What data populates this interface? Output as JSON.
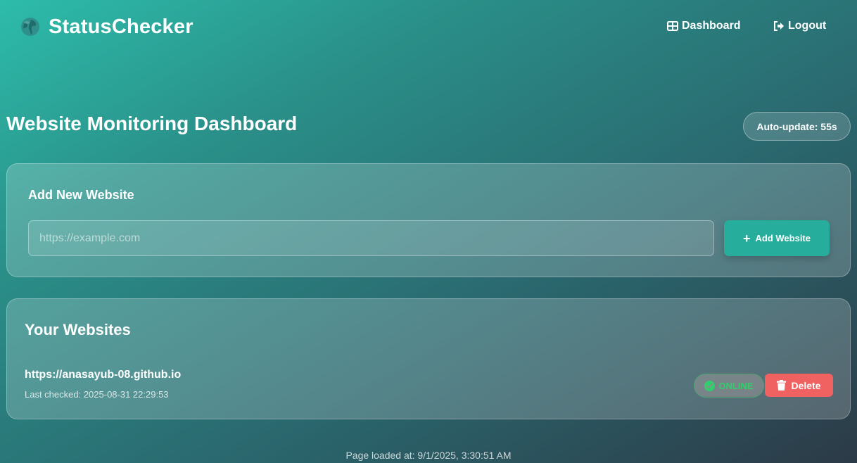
{
  "nav": {
    "brand_icon": "globe-icon",
    "brand_name": "StatusChecker",
    "dashboard_label": "Dashboard",
    "dashboard_icon": "grid-icon",
    "logout_label": "Logout",
    "logout_icon": "logout-icon"
  },
  "header": {
    "title": "Website Monitoring Dashboard",
    "auto_update": "Auto-update: 55s"
  },
  "add_website": {
    "title": "Add New Website",
    "input_placeholder": "https://example.com",
    "input_value": "",
    "button_label": "Add Website",
    "button_icon": "plus-icon"
  },
  "websites": {
    "title": "Your Websites",
    "items": [
      {
        "url": "https://anasayub-08.github.io",
        "last_checked": "Last checked: 2025-08-31 22:29:53",
        "status": "ONLINE",
        "status_icon": "check-circle-icon",
        "delete_label": "Delete",
        "delete_icon": "trash-icon"
      }
    ]
  },
  "footer": {
    "page_loaded": "Page loaded at: 9/1/2025, 3:30:51 AM"
  },
  "colors": {
    "accent": "#26ad9c",
    "online": "#2fcf6b",
    "danger": "#f06262",
    "gradient_start": "#2dbcaa",
    "gradient_end": "#2c3a47"
  }
}
